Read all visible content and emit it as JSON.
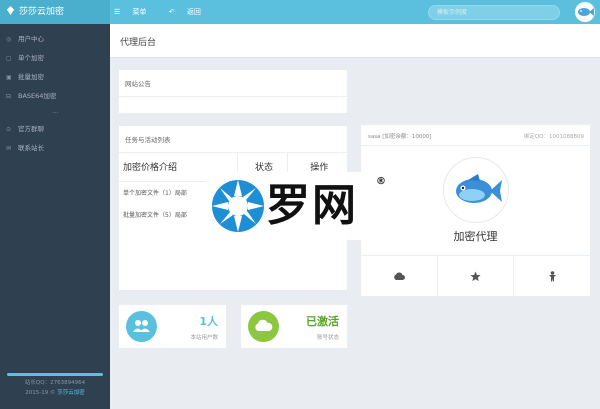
{
  "header": {
    "brand": "莎莎云加密",
    "nav": [
      "菜单",
      "返回"
    ],
    "search_placeholder": "模板示例度"
  },
  "sidebar": {
    "items": [
      {
        "label": "用户中心",
        "icon": "dashboard-icon"
      },
      {
        "label": "单个加密",
        "icon": "file-icon"
      },
      {
        "label": "批量加密",
        "icon": "files-icon"
      },
      {
        "label": "BASE64加密",
        "icon": "code-icon"
      }
    ],
    "separator": "...",
    "items2": [
      {
        "label": "官方群聊",
        "icon": "group-icon"
      },
      {
        "label": "联系站长",
        "icon": "contact-icon"
      }
    ],
    "footer_line1": "站长QQ：2763894964",
    "footer_line2_prefix": "2015-19 © ",
    "footer_line2_link": "莎莎云加密"
  },
  "page": {
    "title": "代理后台"
  },
  "notice": {
    "title": "网站公告"
  },
  "tasks": {
    "title": "任务与活动列表",
    "columns": [
      "加密价格介绍",
      "状态",
      "操作"
    ],
    "rows": [
      "单个加密文件（1）局部",
      "批量加密文件（5）局部"
    ]
  },
  "profile": {
    "user_info": "sasa [加密余额：10000]",
    "qq_info": "绑定QQ：1001088809",
    "role": "加密代理",
    "buttons": [
      "cloud-icon",
      "star-icon",
      "person-icon"
    ]
  },
  "stats": [
    {
      "value": "1人",
      "label": "本站用户数",
      "icon": "users-icon",
      "color": "#5bc0de",
      "value_color": "#5bc0de"
    },
    {
      "value": "已激活",
      "label": "账号状态",
      "icon": "cloud-icon",
      "color": "#8dc63f",
      "value_color": "#5aa22c"
    }
  ],
  "watermark": {
    "text": "罗网",
    "mark": "®"
  }
}
